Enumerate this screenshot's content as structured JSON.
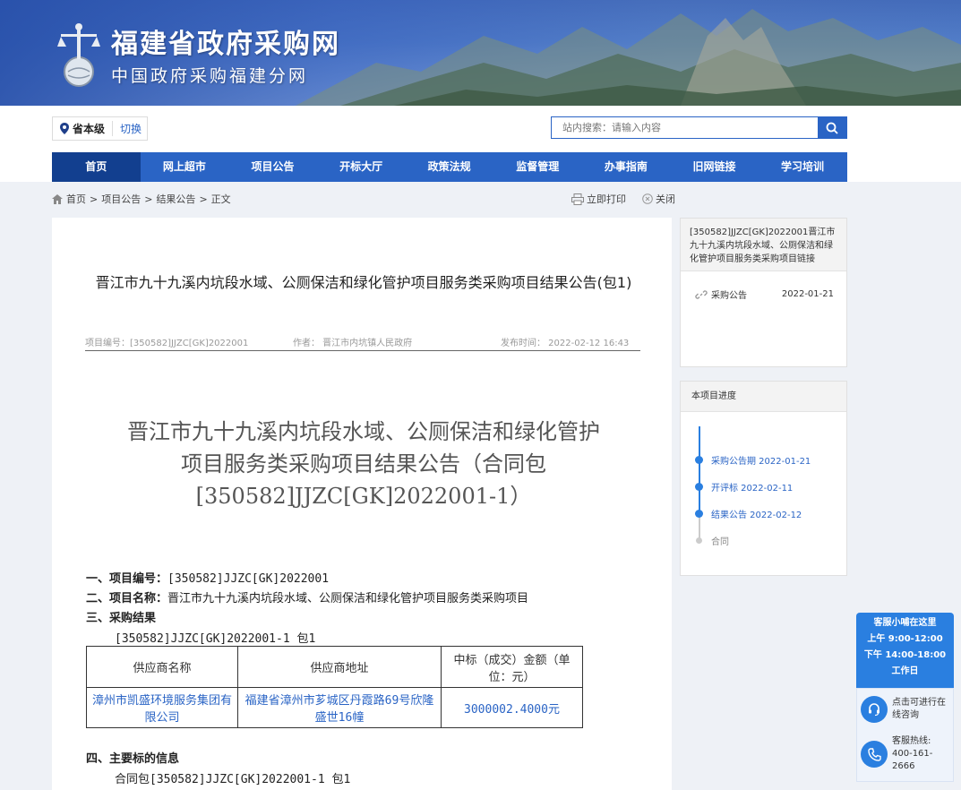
{
  "site": {
    "title": "福建省政府采购网",
    "subtitle": "中国政府采购福建分网"
  },
  "region": {
    "level": "省本级",
    "switch_label": "切换"
  },
  "search": {
    "placeholder": "站内搜索：请输入内容"
  },
  "nav": [
    {
      "label": "首页"
    },
    {
      "label": "网上超市"
    },
    {
      "label": "项目公告"
    },
    {
      "label": "开标大厅"
    },
    {
      "label": "政策法规"
    },
    {
      "label": "监督管理"
    },
    {
      "label": "办事指南"
    },
    {
      "label": "旧网链接"
    },
    {
      "label": "学习培训"
    }
  ],
  "breadcrumb": {
    "home": "首页",
    "sep": ">",
    "level2": "项目公告",
    "level3": "结果公告",
    "level4": "正文"
  },
  "actions": {
    "print": "立即打印",
    "close": "关闭"
  },
  "article": {
    "title": "晋江市九十九溪内坑段水域、公厕保洁和绿化管护项目服务类采购项目结果公告(包1)",
    "meta_code": "项目编号：[350582]JJZC[GK]2022001",
    "meta_author": "作者：  晋江市内坑镇人民政府",
    "meta_time": "发布时间：  2022-02-12 16:43",
    "big_title_line1": "晋江市九十九溪内坑段水域、公厕保洁和绿化管护",
    "big_title_line2": "项目服务类采购项目结果公告（合同包",
    "big_title_line3": "[350582]JJZC[GK]2022001-1）",
    "s1_label": "一、项目编号：",
    "s1_value": "[350582]JJZC[GK]2022001",
    "s2_label": "二、项目名称：",
    "s2_value": "晋江市九十九溪内坑段水域、公厕保洁和绿化管护项目服务类采购项目",
    "s3_label": "三、采购结果",
    "s3_sub": "[350582]JJZC[GK]2022001-1 包1",
    "table": {
      "headers": [
        "供应商名称",
        "供应商地址",
        "中标（成交）金额（单位：元）"
      ],
      "rows": [
        [
          "漳州市凯盛环境服务集团有限公司",
          "福建省漳州市芗城区丹霞路69号欣隆盛世16幢",
          "3000002.4000元"
        ]
      ]
    },
    "s4_label": "四、主要标的信息",
    "s4_sub": "合同包[350582]JJZC[GK]2022001-1 包1"
  },
  "related": {
    "title": "[350582]JJZC[GK]2022001晋江市九十九溪内坑段水域、公厕保洁和绿化管护项目服务类采购项目链接",
    "item_label": "采购公告",
    "item_date": "2022-01-21"
  },
  "progress": {
    "title": "本项目进度",
    "steps": [
      {
        "label": "采购公告期 2022-01-21",
        "done": true
      },
      {
        "label": "开评标 2022-02-11",
        "done": true
      },
      {
        "label": "结果公告 2022-02-12",
        "done": true
      },
      {
        "label": "合同",
        "done": false
      }
    ]
  },
  "service": {
    "line1": "客服小哺在这里",
    "line2": "上午 9:00-12:00",
    "line3": "下午 14:00-18:00",
    "line4": "工作日",
    "chat_label": "点击可进行在线咨询",
    "hotline_label": "客服热线:",
    "hotline_number": "400-161-2666"
  },
  "colors": {
    "primary": "#2a64c5",
    "nav_active": "#123f8f",
    "service_blue": "#2a7fe0"
  }
}
